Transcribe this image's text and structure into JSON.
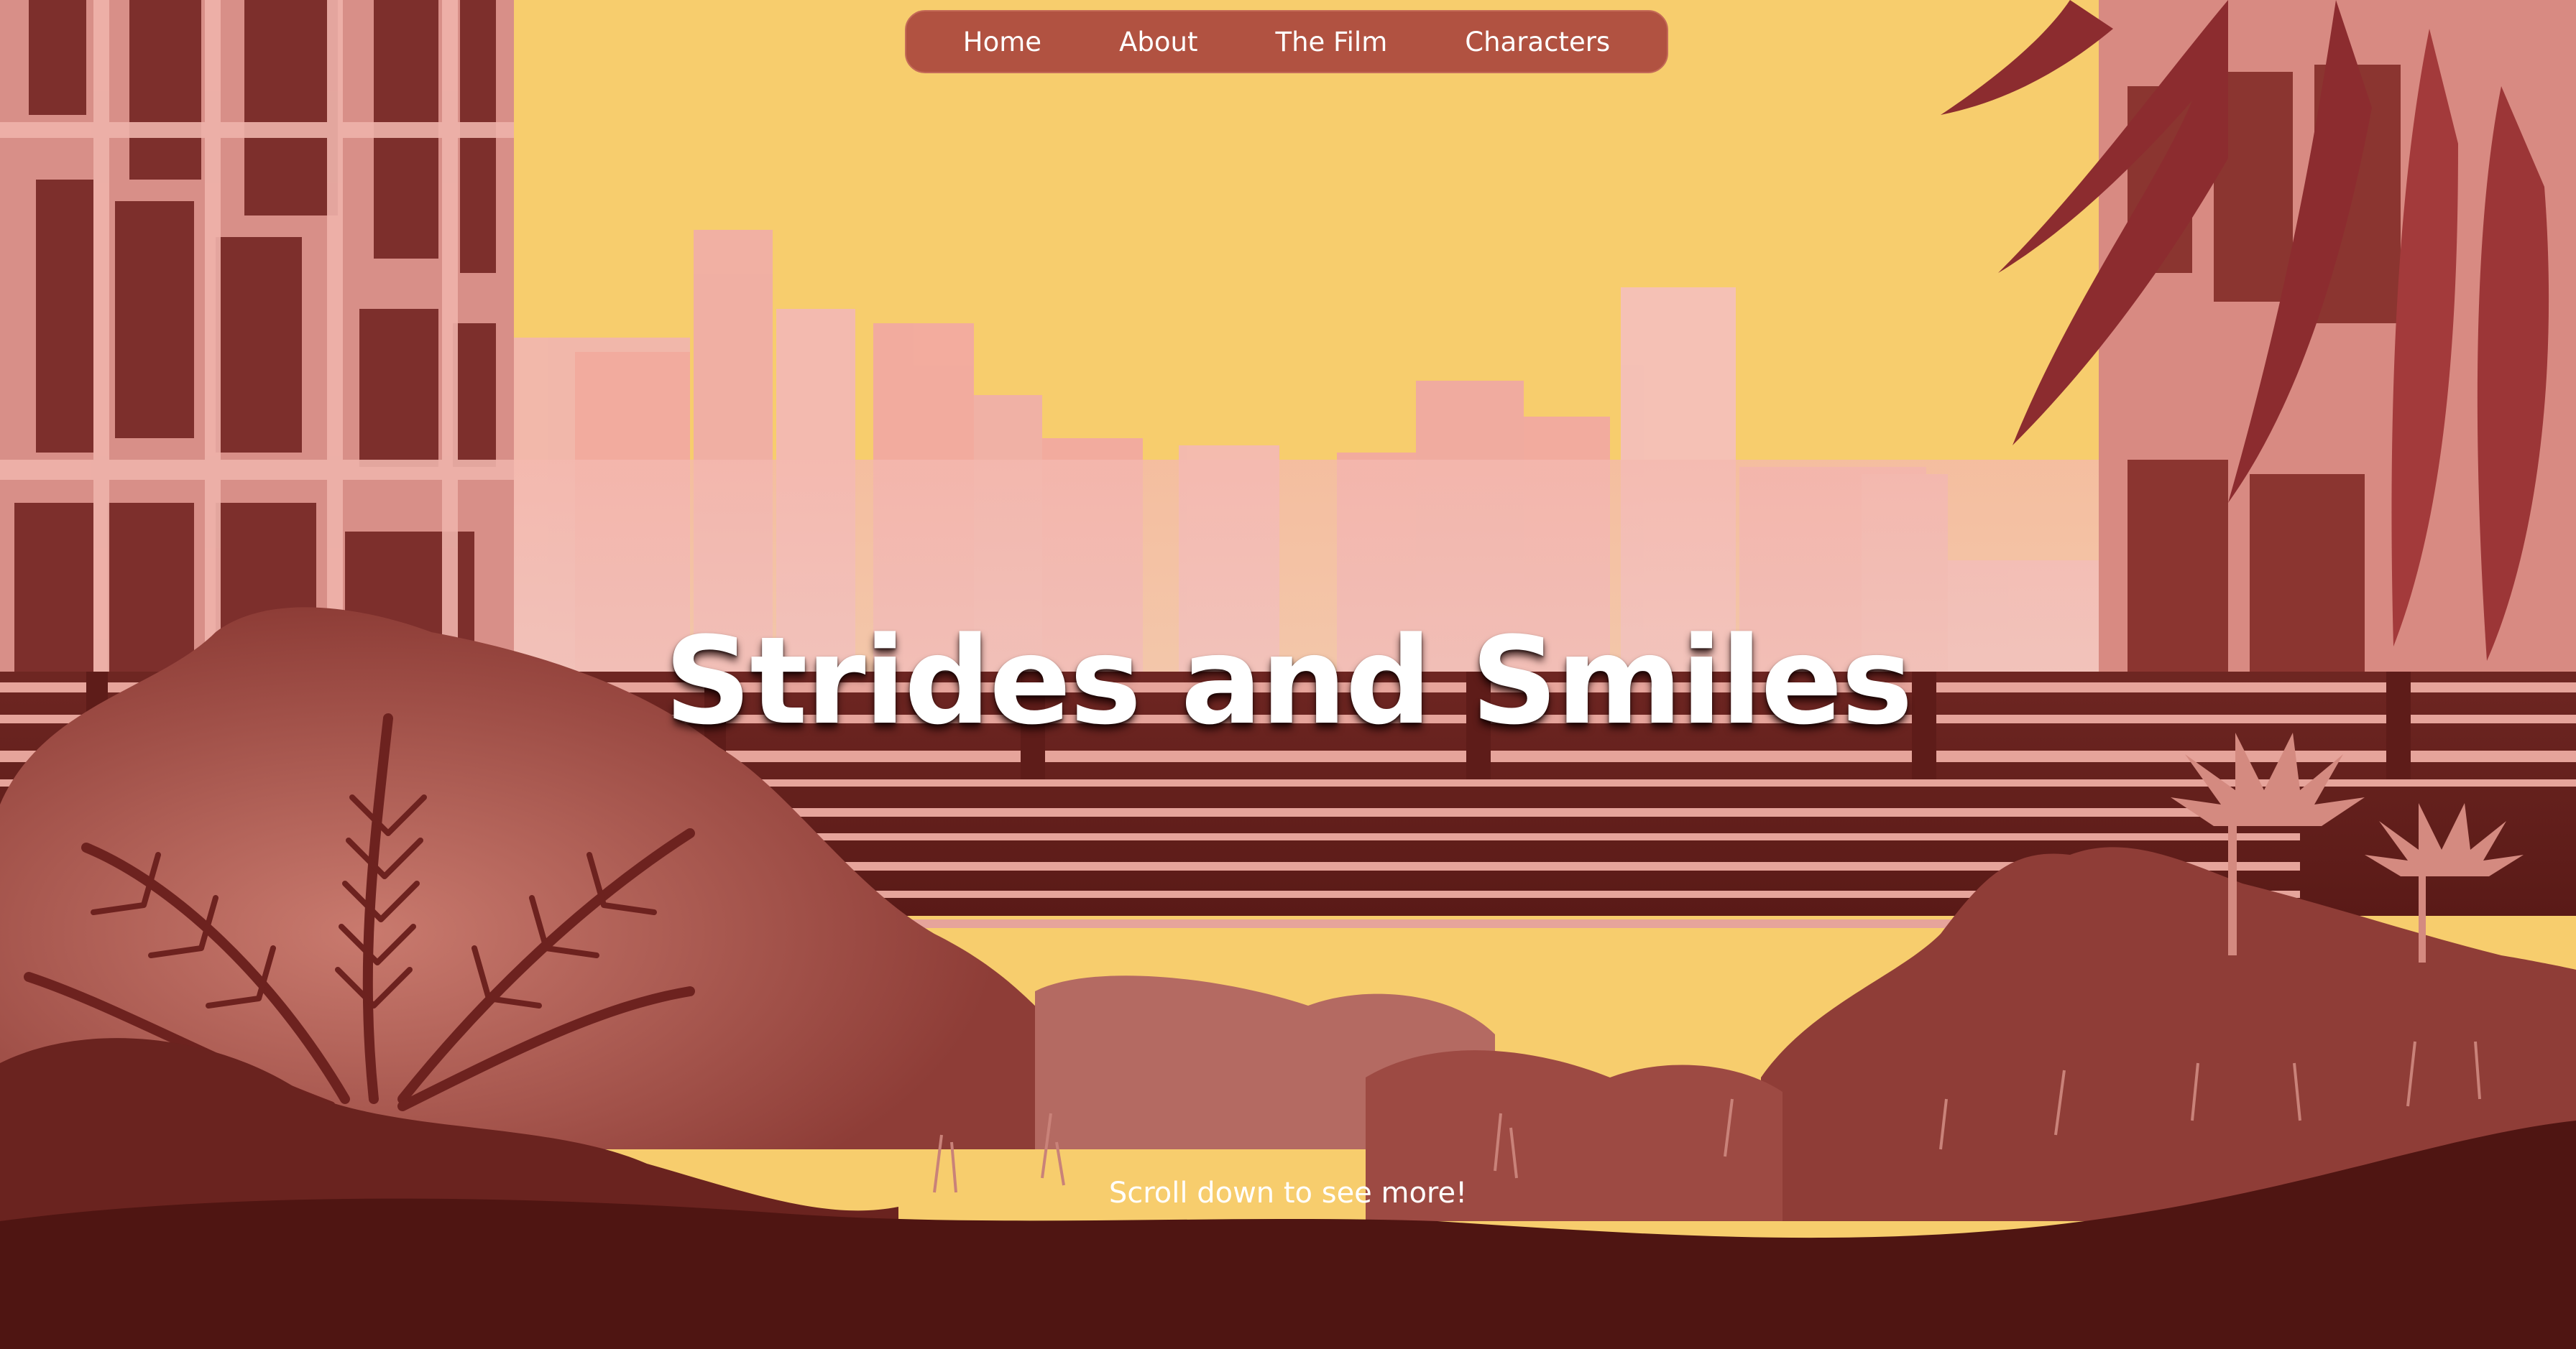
{
  "nav": {
    "items": [
      {
        "label": "Home"
      },
      {
        "label": "About"
      },
      {
        "label": "The Film"
      },
      {
        "label": "Characters"
      }
    ]
  },
  "hero": {
    "title": "Strides and Smiles",
    "scroll_hint": "Scroll down to see more!"
  },
  "colors": {
    "sky": "#f7cd6d",
    "nav_bg": "#b15241",
    "ground": "#4f1512",
    "text": "#ffffff"
  }
}
